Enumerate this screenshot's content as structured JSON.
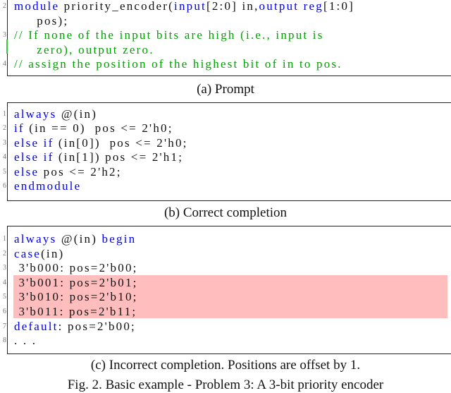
{
  "prompt": {
    "lines": [
      {
        "num": "2",
        "tokens": [
          {
            "t": "module",
            "k": "kw"
          },
          {
            "t": " priority_encoder(",
            "k": ""
          },
          {
            "t": "input",
            "k": "kw"
          },
          {
            "t": "[2:0] in,",
            "k": ""
          },
          {
            "t": "output",
            "k": "kw"
          },
          {
            "t": " ",
            "k": ""
          },
          {
            "t": "reg",
            "k": "kw"
          },
          {
            "t": "[1:0]",
            "k": ""
          }
        ]
      },
      {
        "num": "",
        "tokens": [
          {
            "t": "     pos);",
            "k": ""
          }
        ]
      },
      {
        "num": "3",
        "tokens": [
          {
            "t": "// If none of the input bits are high (i.e., input is",
            "k": "cm"
          }
        ]
      },
      {
        "num": "",
        "tokens": [
          {
            "t": "     zero), output zero.",
            "k": "cm"
          }
        ]
      },
      {
        "num": "4",
        "tokens": [
          {
            "t": "// assign the position of the highest bit of in to pos.",
            "k": "cm"
          }
        ]
      }
    ],
    "caption": "(a) Prompt"
  },
  "correct": {
    "lines": [
      {
        "num": "1",
        "tokens": [
          {
            "t": "always",
            "k": "kw"
          },
          {
            "t": " @(in)",
            "k": ""
          }
        ]
      },
      {
        "num": "2",
        "tokens": [
          {
            "t": "if",
            "k": "kw"
          },
          {
            "t": " (in == 0)  pos <= 2'h0;",
            "k": ""
          }
        ]
      },
      {
        "num": "3",
        "tokens": [
          {
            "t": "else if",
            "k": "kw"
          },
          {
            "t": " (in[0])  pos <= 2'h0;",
            "k": ""
          }
        ]
      },
      {
        "num": "4",
        "tokens": [
          {
            "t": "else if",
            "k": "kw"
          },
          {
            "t": " (in[1]) pos <= 2'h1;",
            "k": ""
          }
        ]
      },
      {
        "num": "5",
        "tokens": [
          {
            "t": "else",
            "k": "kw"
          },
          {
            "t": " pos <= 2'h2;",
            "k": ""
          }
        ]
      },
      {
        "num": "6",
        "tokens": [
          {
            "t": "endmodule",
            "k": "kw"
          }
        ]
      }
    ],
    "caption": "(b) Correct completion"
  },
  "incorrect": {
    "lines": [
      {
        "num": "1",
        "tokens": [
          {
            "t": "always",
            "k": "kw"
          },
          {
            "t": " @(in) ",
            "k": ""
          },
          {
            "t": "begin",
            "k": "kw"
          }
        ]
      },
      {
        "num": "2",
        "tokens": [
          {
            "t": "case",
            "k": "kw"
          },
          {
            "t": "(in)",
            "k": ""
          }
        ]
      },
      {
        "num": "3",
        "tokens": [
          {
            "t": " 3'b000: pos=2'b00;",
            "k": ""
          }
        ]
      },
      {
        "num": "4",
        "tokens": [
          {
            "t": " 3'b001: pos=2'b01;",
            "k": ""
          }
        ]
      },
      {
        "num": "5",
        "tokens": [
          {
            "t": " 3'b010: pos=2'b10;",
            "k": ""
          }
        ]
      },
      {
        "num": "6",
        "tokens": [
          {
            "t": " 3'b011: pos=2'b11;",
            "k": ""
          }
        ]
      },
      {
        "num": "7",
        "tokens": [
          {
            "t": "default",
            "k": "kw"
          },
          {
            "t": ": pos=2'b00;",
            "k": ""
          }
        ]
      },
      {
        "num": "8",
        "tokens": [
          {
            "t": ". . .",
            "k": ""
          }
        ]
      }
    ],
    "highlighted_lines": [
      "4",
      "5",
      "6"
    ],
    "highlight_color": "#ffbdbd",
    "caption": "(c) Incorrect completion. Positions are offset by 1."
  },
  "figure_caption": "Fig. 2.  Basic example - Problem 3: A 3-bit priority encoder",
  "colors": {
    "keyword": "#0000ee",
    "comment": "#00a000",
    "text": "#111111"
  }
}
